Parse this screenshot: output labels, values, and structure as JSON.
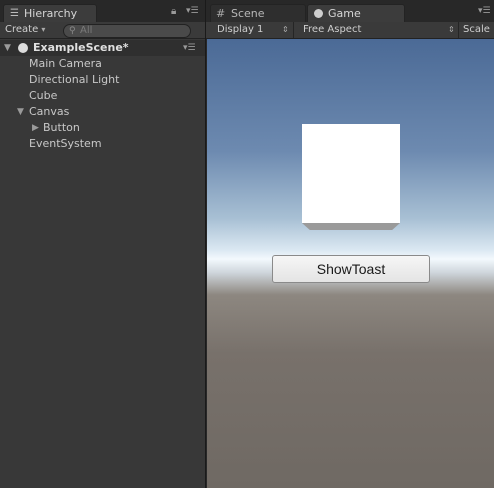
{
  "hierarchy": {
    "tab_label": "Hierarchy",
    "create_label": "Create",
    "search_placeholder": "All",
    "scene_name": "ExampleScene*",
    "items": [
      {
        "label": "Main Camera"
      },
      {
        "label": "Directional Light"
      },
      {
        "label": "Cube"
      },
      {
        "label": "Canvas"
      },
      {
        "label": "Button"
      },
      {
        "label": "EventSystem"
      }
    ]
  },
  "view_tabs": {
    "scene_label": "Scene",
    "game_label": "Game"
  },
  "game_toolbar": {
    "display_label": "Display 1",
    "aspect_label": "Free Aspect",
    "scale_label": "Scale"
  },
  "game_view": {
    "button_label": "ShowToast"
  }
}
